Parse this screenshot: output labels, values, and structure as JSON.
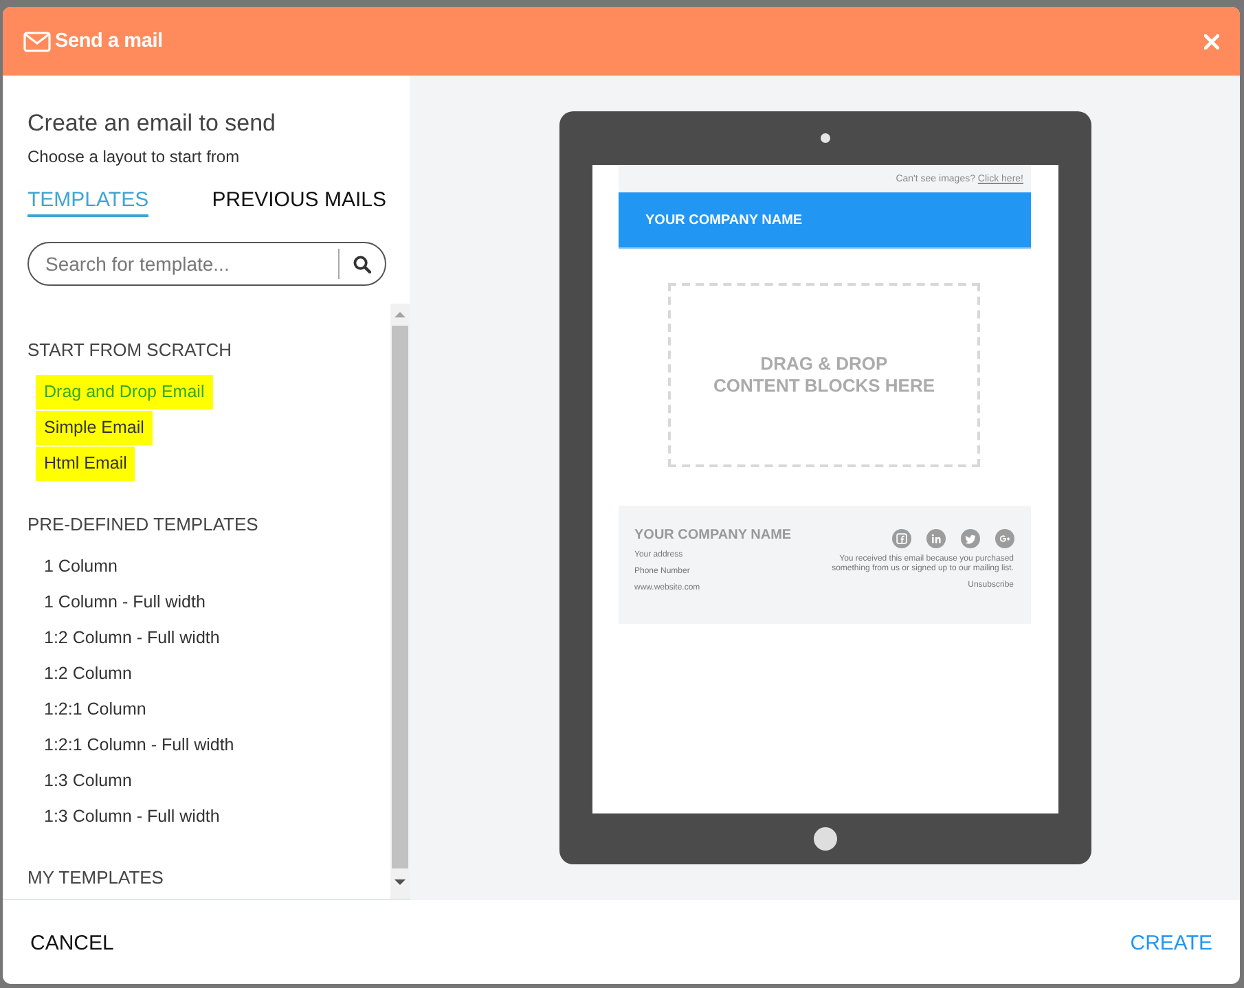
{
  "dialog": {
    "title": "Send a mail"
  },
  "sidebar": {
    "heading": "Create an email to send",
    "subheading": "Choose a layout to start from",
    "tabs": [
      {
        "label": "TEMPLATES",
        "selected": true
      },
      {
        "label": "PREVIOUS MAILS",
        "selected": false
      }
    ],
    "search": {
      "placeholder": "Search for template..."
    },
    "sections": [
      {
        "title": "START FROM SCRATCH",
        "items": [
          {
            "label": "Drag and Drop Email",
            "selected": true,
            "highlighted": true
          },
          {
            "label": "Simple Email",
            "selected": false,
            "highlighted": true
          },
          {
            "label": "Html Email",
            "selected": false,
            "highlighted": true
          }
        ]
      },
      {
        "title": "PRE-DEFINED TEMPLATES",
        "items": [
          {
            "label": "1 Column",
            "selected": false,
            "highlighted": false
          },
          {
            "label": "1 Column - Full width",
            "selected": false,
            "highlighted": false
          },
          {
            "label": "1:2 Column - Full width",
            "selected": false,
            "highlighted": false
          },
          {
            "label": "1:2 Column",
            "selected": false,
            "highlighted": false
          },
          {
            "label": "1:2:1 Column",
            "selected": false,
            "highlighted": false
          },
          {
            "label": "1:2:1 Column - Full width",
            "selected": false,
            "highlighted": false
          },
          {
            "label": "1:3 Column",
            "selected": false,
            "highlighted": false
          },
          {
            "label": "1:3 Column - Full width",
            "selected": false,
            "highlighted": false
          }
        ]
      },
      {
        "title": "MY TEMPLATES"
      }
    ]
  },
  "preview": {
    "top_bar": {
      "text": "Can't see images?",
      "link": "Click here!"
    },
    "banner": "YOUR COMPANY NAME",
    "dropzone": {
      "lines": [
        "DRAG & DROP",
        "CONTENT BLOCKS HERE"
      ]
    },
    "footer": {
      "company": "YOUR COMPANY NAME",
      "address_lines": [
        "Your address",
        "Phone Number",
        "www.website.com"
      ],
      "notice": "You received this email because you purchased something from us or signed up to our mailing list.",
      "unsubscribe": "Unsubscribe"
    }
  },
  "actions": [
    {
      "label": "CANCEL",
      "kind": "secondary"
    },
    {
      "label": "CREATE",
      "kind": "primary"
    }
  ]
}
